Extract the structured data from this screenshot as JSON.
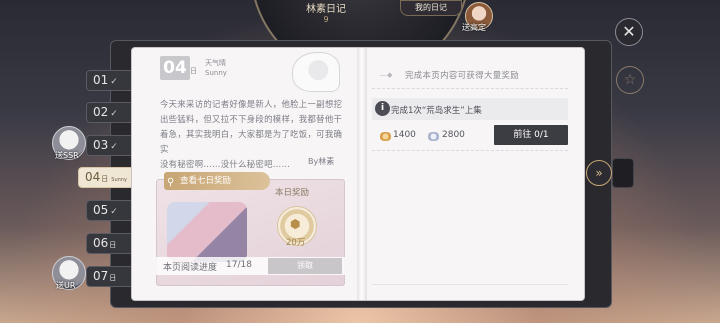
{
  "header": {
    "title": "林素日记",
    "title_number": "9",
    "my_diary_button": "我的日记",
    "top_avatar_label": "送高定"
  },
  "side_tabs": [
    {
      "day": "01",
      "checked": true
    },
    {
      "day": "02",
      "checked": true
    },
    {
      "day": "03",
      "checked": true
    },
    {
      "day": "04",
      "suffix": "日",
      "sub": "Sunny",
      "active": true
    },
    {
      "day": "05",
      "checked": true
    },
    {
      "day": "06",
      "suffix": "日"
    },
    {
      "day": "07",
      "suffix": "日"
    }
  ],
  "side_badges": [
    {
      "label": "送SSR"
    },
    {
      "label": "送UR"
    }
  ],
  "diary": {
    "date": "04",
    "date_unit": "日",
    "weather_label": "天气晴",
    "weather_en": "Sunny",
    "text": "今天来采访的记者好像是新人，他脸上一副想挖\n出些猛料，但又拉不下身段的模样，我都替他干\n着急，其实我明白，大家都是为了吃饭，可我确实\n没有秘密啊……没什么秘密吧……",
    "byline": "By林素"
  },
  "reward_card": {
    "seven_day_button": "查看七日奖励",
    "today_label": "本日奖励",
    "today_amount": "20万",
    "progress_label": "本页阅读进度",
    "progress_value": "17/18",
    "progress_fraction": 0.944,
    "claim_button": "领取"
  },
  "task_panel": {
    "heading": "完成本页内容可获得大量奖励",
    "task_text": "完成1次“荒岛求生”上集",
    "gold_value": "1400",
    "gem_value": "2800",
    "go_button": "前往 0/1"
  },
  "icons": {
    "close": "close-icon",
    "star": "star-icon",
    "next": "chevron-double-right-icon",
    "info": "info-icon"
  },
  "colors": {
    "accent_gold": "#c7a574",
    "dark_button": "#3c3c43",
    "page_bg": "#f7f5f6"
  }
}
